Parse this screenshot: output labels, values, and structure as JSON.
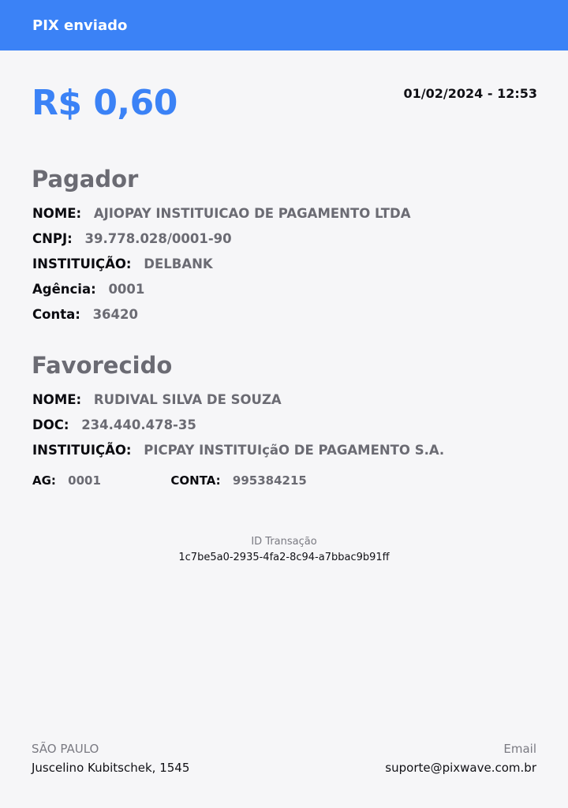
{
  "header": {
    "title": "PIX enviado"
  },
  "summary": {
    "amount": "R$ 0,60",
    "datetime": "01/02/2024 - 12:53"
  },
  "payer": {
    "title": "Pagador",
    "name_label": "NOME:",
    "name_value": "AJIOPAY INSTITUICAO DE PAGAMENTO LTDA",
    "cnpj_label": "CNPJ:",
    "cnpj_value": "39.778.028/0001-90",
    "institution_label": "INSTITUIÇÃO:",
    "institution_value": "DELBANK",
    "agency_label": "Agência:",
    "agency_value": "0001",
    "account_label": "Conta:",
    "account_value": "36420"
  },
  "payee": {
    "title": "Favorecido",
    "name_label": "NOME:",
    "name_value": "RUDIVAL SILVA DE SOUZA",
    "doc_label": "DOC:",
    "doc_value": "234.440.478-35",
    "institution_label": "INSTITUIÇÃO:",
    "institution_value": "PICPAY INSTITUIçãO DE PAGAMENTO S.A.",
    "ag_label": "AG:",
    "ag_value": "0001",
    "account_label": "CONTA:",
    "account_value": "995384215"
  },
  "transaction": {
    "id_label": "ID Transação",
    "id_value": "1c7be5a0-2935-4fa2-8c94-a7bbac9b91ff"
  },
  "footer": {
    "city_label": "SÃO PAULO",
    "address": "Juscelino Kubitschek, 1545",
    "email_label": "Email",
    "email": "suporte@pixwave.com.br"
  },
  "colors": {
    "accent": "#3b82f6",
    "background": "#f6f6f8",
    "muted_text": "#6b6b73"
  }
}
